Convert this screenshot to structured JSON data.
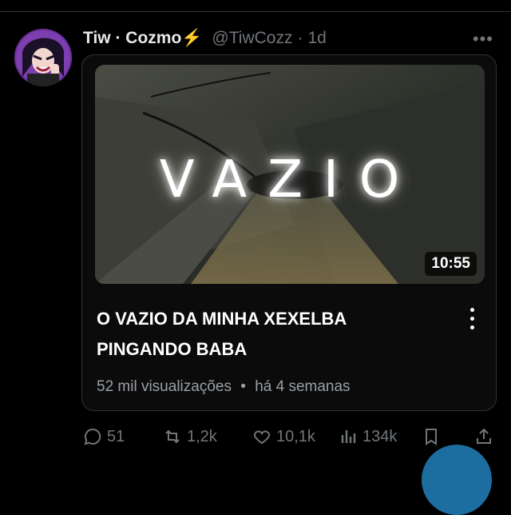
{
  "tweet": {
    "display_name": "Tiw · Cozmo⚡",
    "handle": "@TiwCozz",
    "separator": "·",
    "time": "1d",
    "more": "•••"
  },
  "video": {
    "thumbnail_text": "VAZIO",
    "duration": "10:55",
    "title": "O VAZIO DA MINHA XEXELBA PINGANDO BABA",
    "views": "52 mil visualizações",
    "meta_separator": "•",
    "age": "há 4 semanas"
  },
  "actions": {
    "replies": "51",
    "reposts": "1,2k",
    "likes": "10,1k",
    "views": "134k"
  },
  "colors": {
    "background": "#000000",
    "text_primary": "#e7e9ea",
    "text_secondary": "#71767b",
    "border": "#2f3336",
    "fab": "#1d6ea0"
  }
}
